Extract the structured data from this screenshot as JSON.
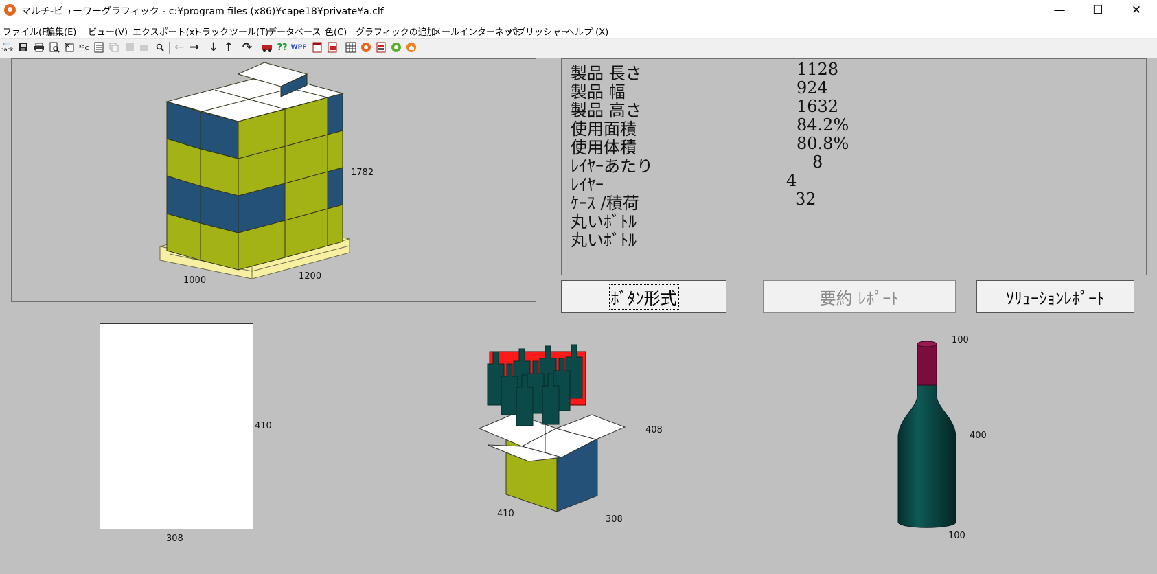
{
  "window": {
    "title": "マルチ-ビューワーグラフィック - c:¥program files (x86)¥cape18¥private¥a.clf",
    "minimize": "—",
    "maximize": "☐",
    "close": "✕"
  },
  "menu": [
    "ファイル(F)",
    "編集(E)",
    "ビュー(V)",
    "エクスポート(x)",
    "トラック",
    "ツール(T)",
    "データベース",
    "色(C)",
    "グラフィックの追加",
    "メール",
    "インターネット",
    "パブリッシャー",
    "ヘルプ (X)"
  ],
  "toolbar": {
    "back_label": "back",
    "wpf_label": "WPF",
    "help_label": "??"
  },
  "stats": [
    {
      "label": "製品 長さ",
      "value": "1128"
    },
    {
      "label": "製品 幅",
      "value": "924"
    },
    {
      "label": "製品 高さ",
      "value": "1632"
    },
    {
      "label": "使用面積",
      "value": "84.2%"
    },
    {
      "label": "使用体積",
      "value": "80.8%"
    },
    {
      "label": "ﾚｲﾔｰあたり",
      "value": "8"
    },
    {
      "label": "ﾚｲﾔｰ",
      "value": "4"
    },
    {
      "label": "ｹｰｽ /積荷",
      "value": "32"
    },
    {
      "label": "丸いﾎﾞﾄﾙ",
      "value": ""
    },
    {
      "label": "丸いﾎﾞﾄﾙ",
      "value": ""
    }
  ],
  "buttons": {
    "button_style": "ﾎﾞﾀﾝ形式",
    "summary_report": "要約 ﾚﾎﾟｰﾄ",
    "solution_report": "ｿﾘｭｰｼｮﾝﾚﾎﾟｰﾄ"
  },
  "pallet": {
    "height": "1782",
    "width": "1000",
    "length": "1200"
  },
  "case_face": {
    "height": "410",
    "width": "308"
  },
  "case_3d": {
    "height": "408",
    "width": "410",
    "depth": "308"
  },
  "bottle": {
    "top": "100",
    "height": "400",
    "bottom": "100"
  },
  "colors": {
    "lime": "#a3b215",
    "navy": "#245178",
    "red": "#ff1a1a",
    "bottle_green": "#0b4a48",
    "cap": "#7a0d3c",
    "pallet": "#f7f0a3"
  }
}
